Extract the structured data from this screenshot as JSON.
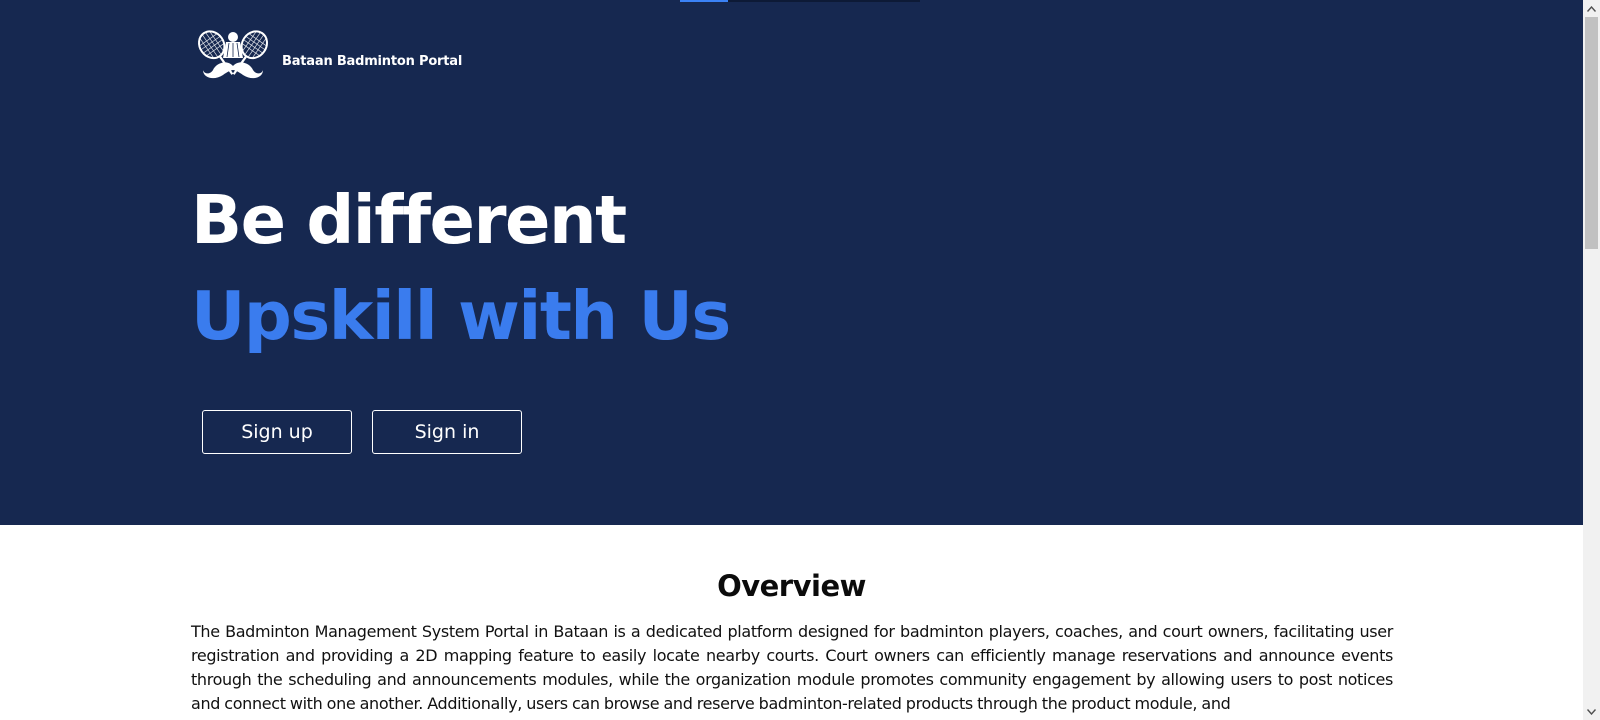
{
  "brand": {
    "name": "Bataan Badminton Portal",
    "logo_icon": "badminton-rackets-shuttlecock-mustache-icon"
  },
  "hero": {
    "headline": "Be different",
    "subheadline": "Upskill with Us",
    "signup_label": "Sign up",
    "signin_label": "Sign in"
  },
  "overview": {
    "title": "Overview",
    "text": "The Badminton Management System Portal in Bataan is a dedicated platform designed for badminton players, coaches, and court owners, facilitating user registration and providing a 2D mapping feature to easily locate nearby courts. Court owners can efficiently manage reservations and announce events through the scheduling and announcements modules, while the organization module promotes community engagement by allowing users to post notices and connect with one another. Additionally, users can browse and reserve badminton-related products through the product module, and"
  },
  "colors": {
    "hero_background": "#162850",
    "accent_blue": "#3a7cee",
    "page_background": "#ffffff",
    "text_dark": "#111111"
  },
  "scrollbar": {
    "up_icon": "scroll-up-arrow-icon",
    "down_icon": "scroll-down-arrow-icon"
  }
}
